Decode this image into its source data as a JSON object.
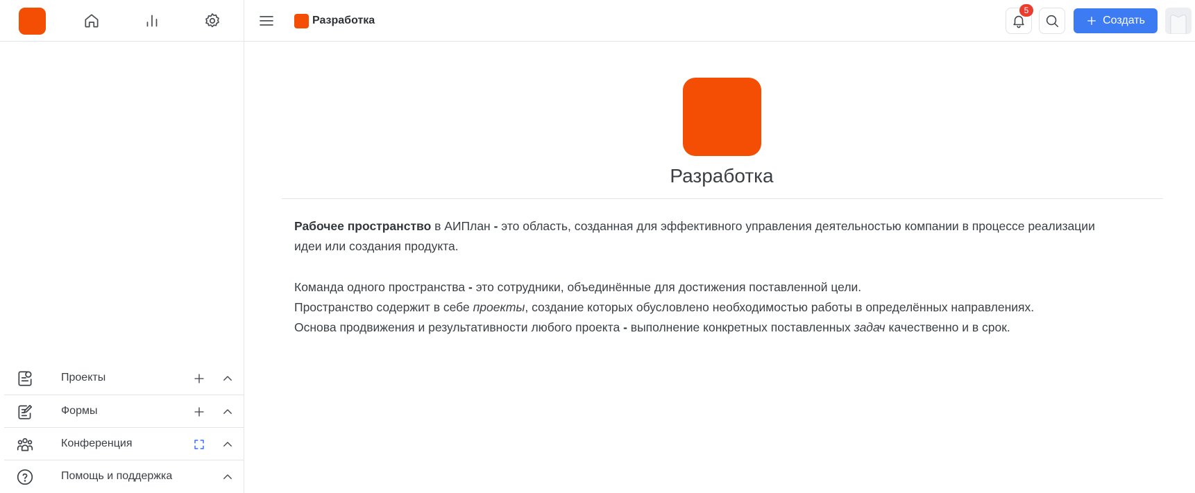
{
  "sidebar": {
    "nav_icons": [
      "home-icon",
      "chart-icon",
      "gear-icon"
    ],
    "items": [
      {
        "label": "Проекты",
        "icon": "projects-icon",
        "actions": [
          "plus",
          "chevron-up"
        ]
      },
      {
        "label": "Формы",
        "icon": "forms-icon",
        "actions": [
          "plus",
          "chevron-up"
        ]
      },
      {
        "label": "Конференция",
        "icon": "people-icon",
        "actions": [
          "expand",
          "chevron-up"
        ]
      },
      {
        "label": "Помощь и поддержка",
        "icon": "help-icon",
        "actions": [
          "chevron-up"
        ]
      }
    ]
  },
  "header": {
    "workspace_name": "Разработка",
    "notifications_count": "5",
    "create_label": "Создать"
  },
  "main": {
    "title": "Разработка",
    "p1": {
      "bold": "Рабочее пространство",
      "in": " в АИПлан ",
      "dash": "-",
      "rest": " это область, созданная для эффективного управления деятельностью компании в процессе реализации идеи или создания продукта."
    },
    "p2": {
      "a": "Команда одного пространства ",
      "dash": "-",
      "b": " это сотрудники, объединённые для достижения поставленной цели."
    },
    "p3": {
      "a": "Пространство содержит в себе ",
      "i": "проекты",
      "b": ", создание которых обусловлено необходимостью работы в определённых направлениях."
    },
    "p4": {
      "a": "Основа продвижения и результативности любого проекта ",
      "dash": "-",
      "b": " выполнение конкретных поставленных ",
      "i": "задач",
      "c": " качественно и в срок."
    }
  },
  "colors": {
    "accent": "#f44e04",
    "primary_button": "#3d7bf2",
    "badge": "#ea3d2f"
  }
}
